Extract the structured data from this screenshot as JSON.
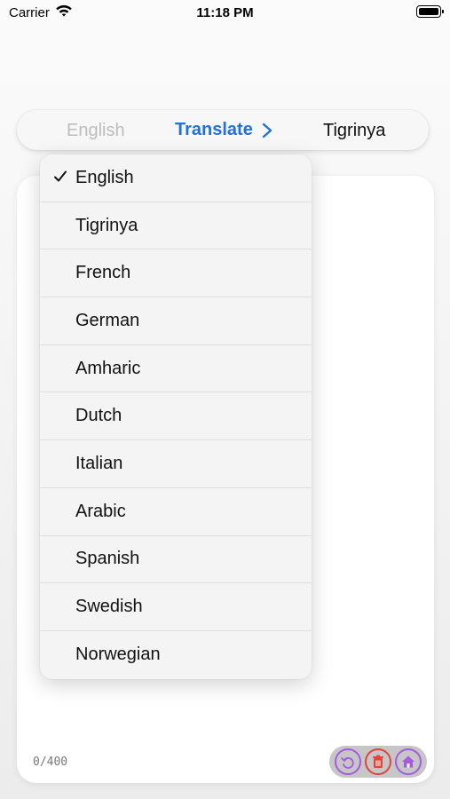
{
  "status_bar": {
    "carrier": "Carrier",
    "time": "11:18 PM"
  },
  "language_bar": {
    "source_language": "English",
    "action_label": "Translate",
    "target_language": "Tigrinya"
  },
  "editor": {
    "char_count": "0/400",
    "actions": [
      {
        "icon": "undo-icon",
        "color": "#a65ae0"
      },
      {
        "icon": "trash-icon",
        "color": "#e0453b"
      },
      {
        "icon": "home-icon",
        "color": "#a65ae0"
      }
    ]
  },
  "language_menu": {
    "selected": "English",
    "items": [
      {
        "label": "English",
        "checked": true
      },
      {
        "label": "Tigrinya",
        "checked": false
      },
      {
        "label": "French",
        "checked": false
      },
      {
        "label": "German",
        "checked": false
      },
      {
        "label": "Amharic",
        "checked": false
      },
      {
        "label": "Dutch",
        "checked": false
      },
      {
        "label": "Italian",
        "checked": false
      },
      {
        "label": "Arabic",
        "checked": false
      },
      {
        "label": "Spanish",
        "checked": false
      },
      {
        "label": "Swedish",
        "checked": false
      },
      {
        "label": "Norwegian",
        "checked": false
      }
    ]
  },
  "colors": {
    "accent": "#1f72d8",
    "muted_text": "#bdbdbd",
    "purple_action": "#a65ae0",
    "red_action": "#e0453b"
  }
}
